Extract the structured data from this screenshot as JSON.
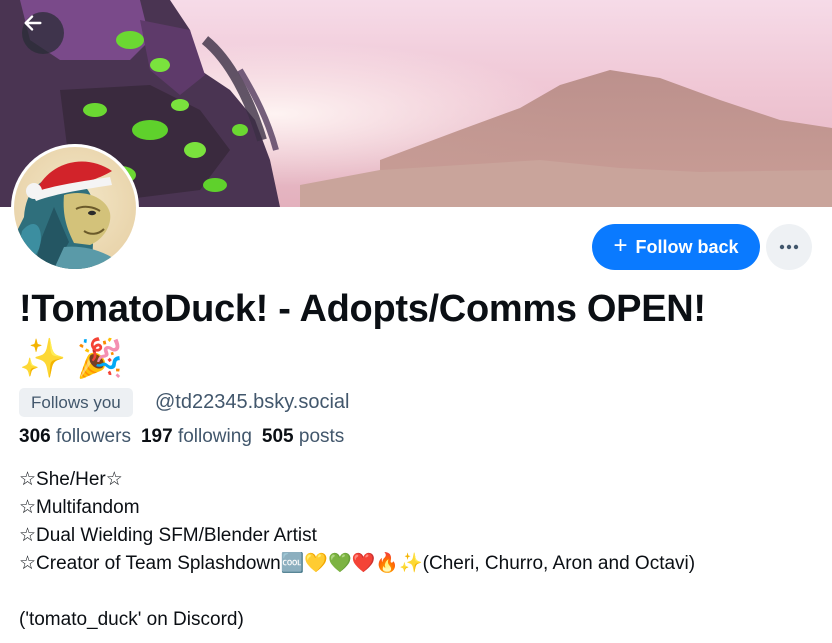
{
  "header": {
    "back_label": "Back"
  },
  "profile": {
    "display_name": "!TomatoDuck! - Adopts/Comms OPEN!",
    "name_emojis": "✨ 🎉",
    "follows_you": "Follows you",
    "handle": "@td22345.bsky.social",
    "follow_button_label": "Follow back",
    "stats": {
      "followers_count": "306",
      "followers_label": "followers",
      "following_count": "197",
      "following_label": "following",
      "posts_count": "505",
      "posts_label": "posts"
    },
    "bio": [
      "☆She/Her☆",
      "☆Multifandom",
      "☆Dual Wielding SFM/Blender Artist",
      "☆Creator of Team Splashdown🆒💛💚❤️🔥✨(Cheri, Churro, Aron and Octavi)",
      "",
      "('tomato_duck' on Discord)"
    ]
  },
  "colors": {
    "accent": "#0a7aff",
    "secondary_text": "#42576c",
    "badge_bg": "#edf0f3"
  }
}
